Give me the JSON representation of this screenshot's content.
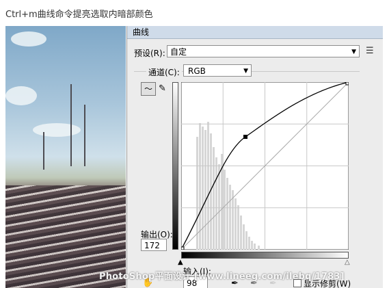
{
  "caption": "Ctrl+m曲线命令提亮选取内暗部颜色",
  "dialog": {
    "title": "曲线",
    "preset_label": "预设(R):",
    "preset_value": "自定",
    "channel_label": "通道(C):",
    "channel_value": "RGB",
    "output_label": "输出(O):",
    "output_value": "172",
    "input_label": "输入(I):",
    "input_value": "98",
    "show_clipping_label": "显示修剪(W)"
  },
  "curve": {
    "control_point_input": 98,
    "control_point_output": 172
  },
  "watermark": "PhotoShop平面设计 [www.lineeg.com/ilebq/1783]",
  "icons": {
    "preset_menu": "list-menu-icon",
    "curve_tool": "curve-tool-icon",
    "pencil_tool": "pencil-icon",
    "hand_tool": "hand-icon",
    "black_eyedropper": "eyedropper-black-icon",
    "gray_eyedropper": "eyedropper-gray-icon",
    "white_eyedropper": "eyedropper-white-icon"
  }
}
